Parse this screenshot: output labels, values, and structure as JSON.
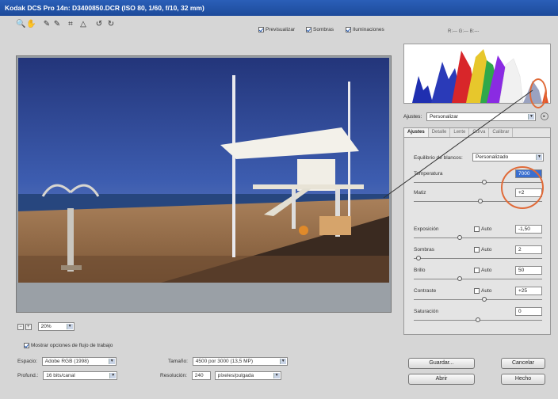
{
  "title": "Kodak DCS Pro 14n: D3400850.DCR (ISO 80, 1/60, f/10, 32 mm)",
  "toolbar": {
    "tools": [
      "zoom-icon",
      "hand-icon",
      "eyedropper-icon",
      "color-sampler-icon",
      "crop-icon",
      "straighten-icon",
      "rotate-left-icon",
      "rotate-right-icon"
    ],
    "tool_glyphs": [
      "🔍",
      "✋",
      "✎",
      "✎",
      "⌗",
      "△",
      "↺",
      "↻"
    ],
    "previsualizar": "Previsualizar",
    "sombras": "Sombras",
    "iluminaciones": "Iluminaciones",
    "rgb": "R:--- G:--- B:---"
  },
  "zoom": "20%",
  "workflow": {
    "mostrar_label": "Mostrar opciones de flujo de trabajo",
    "espacio_label": "Espacio:",
    "espacio_value": "Adobe RGB (1998)",
    "profund_label": "Profund.:",
    "profund_value": "16 bits/canal",
    "tamano_label": "Tamaño:",
    "tamano_value": "4500 por 3000 (13,5 MP)",
    "resolucion_label": "Resolución:",
    "resolucion_value": "240",
    "resolucion_unit": "píxeles/pulgada"
  },
  "ajustes": {
    "label": "Ajustes:",
    "value": "Personalizar"
  },
  "panel": {
    "tabs": [
      "Ajustes",
      "Detalle",
      "Lente",
      "Curva",
      "Calibrar"
    ],
    "balance_label": "Equilibrio de blancos:",
    "balance_value": "Personalizado",
    "auto_label": "Auto",
    "controls": [
      {
        "label": "Temperatura",
        "value": "7000",
        "auto": false,
        "knob": 0.55
      },
      {
        "label": "Matiz",
        "value": "+2",
        "auto": false,
        "knob": 0.52
      },
      {
        "label": "Exposición",
        "value": "-1,50",
        "auto": true,
        "knob": 0.35
      },
      {
        "label": "Sombras",
        "value": "2",
        "auto": true,
        "knob": 0.02
      },
      {
        "label": "Brillo",
        "value": "50",
        "auto": true,
        "knob": 0.35
      },
      {
        "label": "Contraste",
        "value": "+25",
        "auto": true,
        "knob": 0.55
      },
      {
        "label": "Saturación",
        "value": "0",
        "auto": false,
        "knob": 0.5
      }
    ]
  },
  "buttons": {
    "guardar": "Guardar...",
    "abrir": "Abrir",
    "cancelar": "Cancelar",
    "hecho": "Hecho"
  },
  "colors": {
    "titlebar": "#2a5fb8",
    "annotation": "#e06a38",
    "selected_field": "#3a6fd0"
  }
}
